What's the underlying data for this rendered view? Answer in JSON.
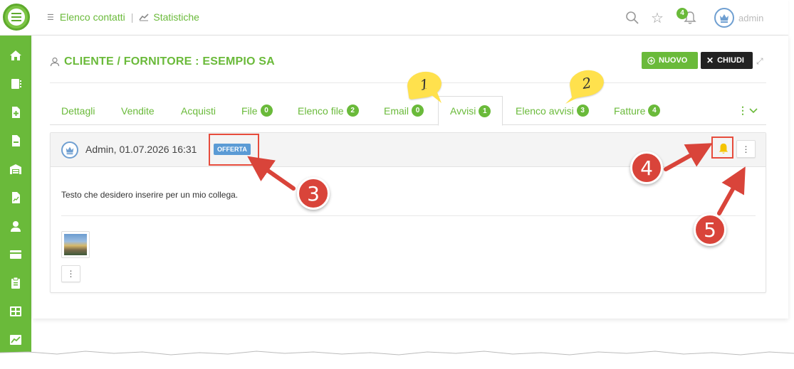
{
  "topbar": {
    "nav_contacts": "Elenco contatti",
    "nav_sep": "|",
    "nav_stats": "Statistiche",
    "notifications_count": "4",
    "user_name": "admin"
  },
  "sidebar": {
    "items": [
      "home-icon",
      "contacts-icon",
      "add-document-icon",
      "document-icon",
      "warehouse-icon",
      "chart-file-icon",
      "user-icon",
      "card-icon",
      "clipboard-icon",
      "grid-icon",
      "trend-icon"
    ]
  },
  "page": {
    "title": "CLIENTE / FORNITORE : ESEMPIO SA",
    "new_button": "NUOVO",
    "close_button": "CHIUDI"
  },
  "tabs": [
    {
      "label": "Dettagli",
      "badge": ""
    },
    {
      "label": "Vendite",
      "badge": ""
    },
    {
      "label": "Acquisti",
      "badge": ""
    },
    {
      "label": "File",
      "badge": "0"
    },
    {
      "label": "Elenco file",
      "badge": "2"
    },
    {
      "label": "Email",
      "badge": "0"
    },
    {
      "label": "Avvisi",
      "badge": "1"
    },
    {
      "label": "Elenco avvisi",
      "badge": "3"
    },
    {
      "label": "Fatture",
      "badge": "4"
    }
  ],
  "note": {
    "author": "Admin, 01.07.2026 16:31",
    "tag": "OFFERTA",
    "text": "Testo che desidero inserire per un mio collega."
  },
  "annotations": {
    "sticky_1": "1",
    "sticky_2": "2",
    "callout_3": "3",
    "callout_4": "4",
    "callout_5": "5"
  },
  "colors": {
    "brand_green": "#6aba3a",
    "tag_blue": "#5b9bd5",
    "annotation_red": "#d9443a",
    "bell_yellow": "#f5c400"
  }
}
